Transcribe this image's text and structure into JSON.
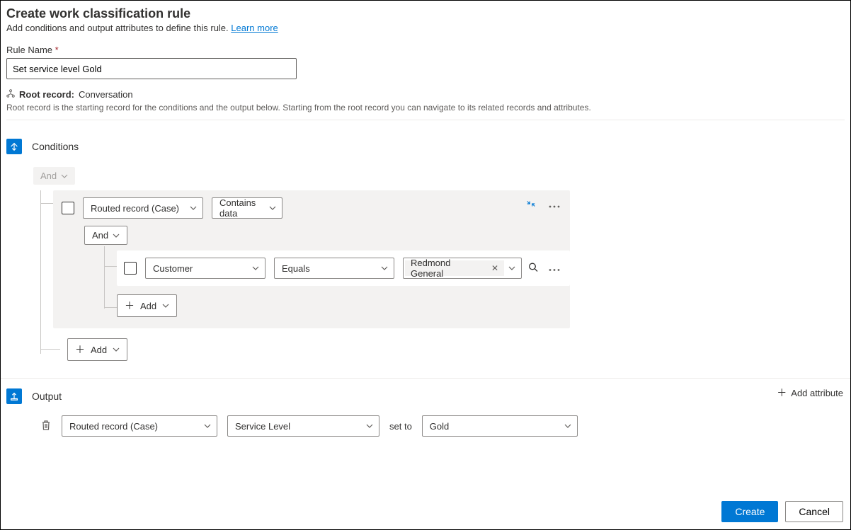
{
  "header": {
    "title": "Create work classification rule",
    "subtitle": "Add conditions and output attributes to define this rule.",
    "learn_more": "Learn more"
  },
  "rule": {
    "label": "Rule Name",
    "value": "Set service level Gold"
  },
  "root_record": {
    "label": "Root record:",
    "value": "Conversation",
    "hint": "Root record is the starting record for the conditions and the output below. Starting from the root record you can navigate to its related records and attributes."
  },
  "conditions": {
    "title": "Conditions",
    "group_op": "And",
    "rows": [
      {
        "field": "Routed record (Case)",
        "operator": "Contains data"
      }
    ],
    "nested_op": "And",
    "nested_rows": [
      {
        "field": "Customer",
        "operator": "Equals",
        "value": "Redmond General"
      }
    ],
    "add_label": "Add"
  },
  "output": {
    "title": "Output",
    "add_attribute_label": "Add attribute",
    "row": {
      "entity": "Routed record (Case)",
      "attribute": "Service Level",
      "set_to_label": "set to",
      "value": "Gold"
    }
  },
  "footer": {
    "create": "Create",
    "cancel": "Cancel"
  }
}
